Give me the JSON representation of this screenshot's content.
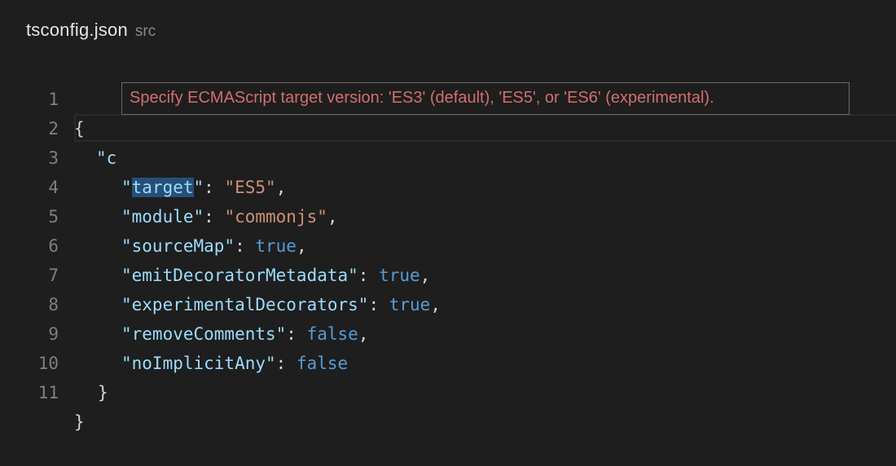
{
  "tab": {
    "filename": "tsconfig.json",
    "folder": "src"
  },
  "hover": {
    "message": "Specify ECMAScript target version: 'ES3' (default), 'ES5', or 'ES6' (experimental)."
  },
  "line_numbers": [
    "1",
    "2",
    "3",
    "4",
    "5",
    "6",
    "7",
    "8",
    "9",
    "10",
    "11"
  ],
  "code": {
    "l1": "{",
    "l2_quote": "\"c",
    "l3": {
      "q1": "\"",
      "key": "target",
      "q2": "\"",
      "colon": ": ",
      "value": "\"ES5\"",
      "comma": ","
    },
    "l4": {
      "key": "\"module\"",
      "colon": ": ",
      "value": "\"commonjs\"",
      "comma": ","
    },
    "l5": {
      "key": "\"sourceMap\"",
      "colon": ": ",
      "value": "true",
      "comma": ","
    },
    "l6": {
      "key": "\"emitDecoratorMetadata\"",
      "colon": ": ",
      "value": "true",
      "comma": ","
    },
    "l7": {
      "key": "\"experimentalDecorators\"",
      "colon": ": ",
      "value": "true",
      "comma": ","
    },
    "l8": {
      "key": "\"removeComments\"",
      "colon": ": ",
      "value": "false",
      "comma": ","
    },
    "l9": {
      "key": "\"noImplicitAny\"",
      "colon": ": ",
      "value": "false"
    },
    "l10": "}",
    "l11": "}"
  },
  "colors": {
    "background": "#1e1e1e",
    "key": "#9cdcfe",
    "string": "#ce9178",
    "boolean": "#569cd6",
    "hover_text": "#d26e6e"
  }
}
